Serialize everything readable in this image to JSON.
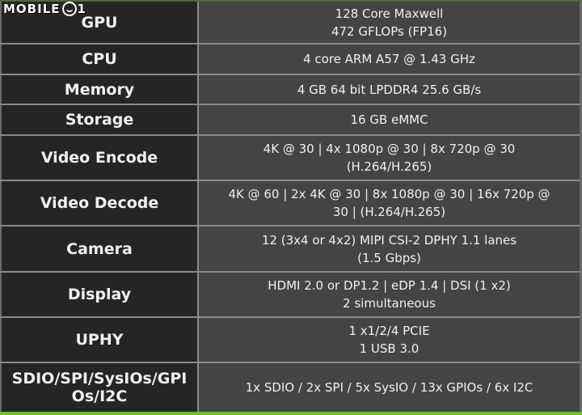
{
  "watermark": {
    "brand": "MOBILE",
    "suffix": "1",
    "logo_icon": "devil-face-icon"
  },
  "colors": {
    "label_bg": "#252525",
    "value_bg": "#444444",
    "grid_line": "#8a8a8a",
    "accent_green": "#6fbf2a"
  },
  "spec_rows": [
    {
      "label": "GPU",
      "value": "128 Core Maxwell\n472 GFLOPs (FP16)"
    },
    {
      "label": "CPU",
      "value": "4 core ARM A57  @ 1.43 GHz"
    },
    {
      "label": "Memory",
      "value": "4 GB 64 bit LPDDR4 25.6 GB/s"
    },
    {
      "label": "Storage",
      "value": "16 GB eMMC"
    },
    {
      "label": "Video Encode",
      "value": "4K @ 30 | 4x 1080p @ 30 | 8x 720p @ 30\n(H.264/H.265)"
    },
    {
      "label": "Video Decode",
      "value": "4K @ 60 | 2x 4K @ 30 | 8x 1080p @ 30 | 16x 720p @\n30  | (H.264/H.265)"
    },
    {
      "label": "Camera",
      "value": "12 (3x4 or 4x2) MIPI CSI-2 DPHY 1.1 lanes\n(1.5 Gbps)"
    },
    {
      "label": "Display",
      "value": "HDMI 2.0 or DP1.2 | eDP 1.4 | DSI (1 x2)\n2 simultaneous"
    },
    {
      "label": "UPHY",
      "value": "1 x1/2/4 PCIE\n1 USB 3.0"
    },
    {
      "label": "SDIO/SPI/SysIOs/GPIOs/I2C",
      "value": "1x SDIO / 2x SPI / 5x SysIO / 13x GPIOs / 6x I2C"
    }
  ]
}
